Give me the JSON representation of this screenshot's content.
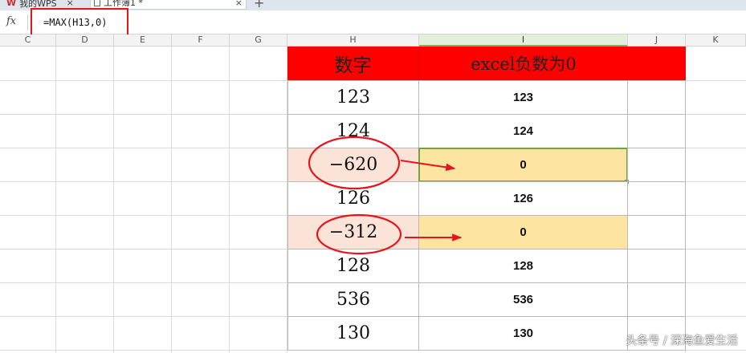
{
  "tabs": [
    {
      "label": "我的WPS",
      "close": "×"
    },
    {
      "label": "工作簿1 *",
      "close": "×"
    }
  ],
  "new_tab": "+",
  "formula_bar": {
    "fx": "fx",
    "formula": "=MAX(H13,0)"
  },
  "columns": [
    "C",
    "D",
    "E",
    "F",
    "G",
    "H",
    "I",
    "J",
    "K"
  ],
  "selected_column": "I",
  "table": {
    "header": {
      "h": "数字",
      "i": "excel负数为0"
    },
    "rows": [
      {
        "h": "123",
        "i": "123",
        "negative": false
      },
      {
        "h": "124",
        "i": "124",
        "negative": false
      },
      {
        "h": "−620",
        "i": "0",
        "negative": true
      },
      {
        "h": "126",
        "i": "126",
        "negative": false
      },
      {
        "h": "−312",
        "i": "0",
        "negative": true
      },
      {
        "h": "128",
        "i": "128",
        "negative": false
      },
      {
        "h": "536",
        "i": "536",
        "negative": false
      },
      {
        "h": "130",
        "i": "130",
        "negative": false
      }
    ]
  },
  "colors": {
    "header_fill": "#ff0000",
    "negative_h_fill": "#fbe3d8",
    "negative_i_fill": "#fde4a0",
    "annotation": "#e8141b",
    "selection": "#6da540"
  },
  "watermark": "头条号 / 深海鱼爱生活"
}
